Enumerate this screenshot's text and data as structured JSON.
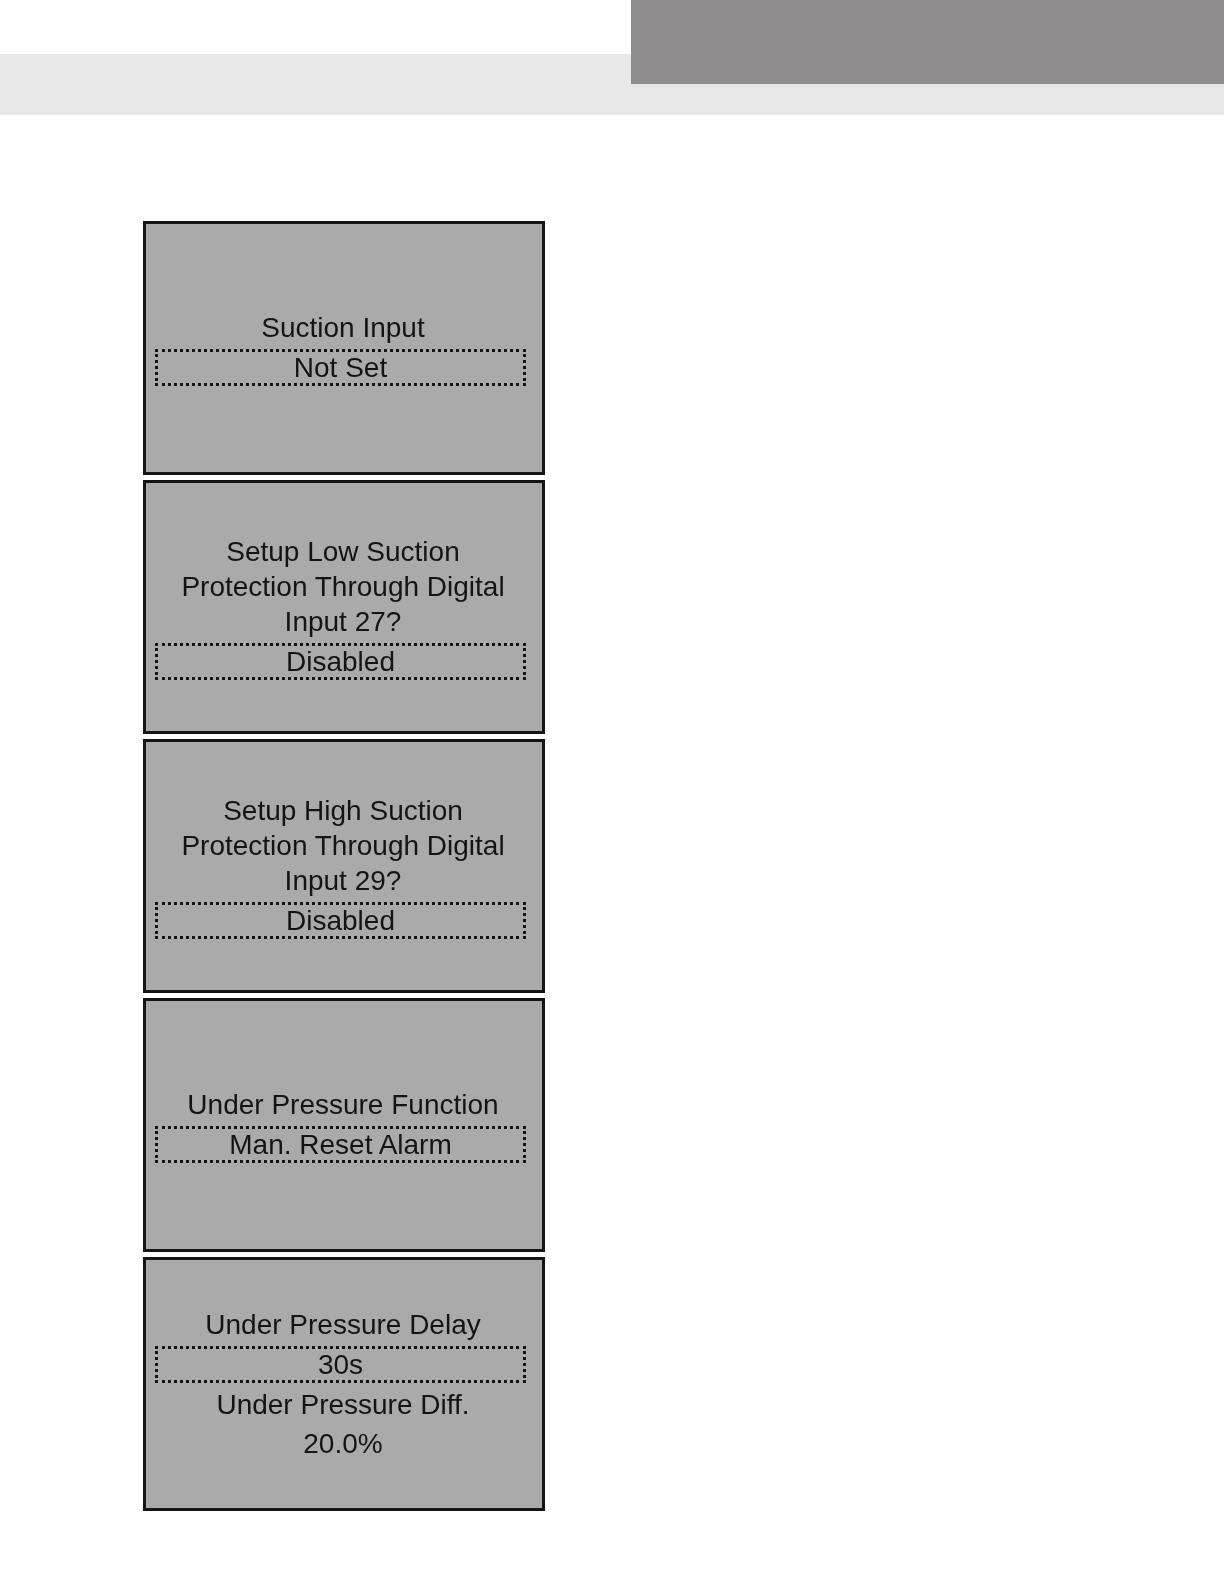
{
  "screens": [
    {
      "items": [
        {
          "kind": "label",
          "text": "Suction Input"
        },
        {
          "kind": "field",
          "value": "Not Set"
        }
      ]
    },
    {
      "items": [
        {
          "kind": "label",
          "text": "Setup Low Suction Protection Through Digital Input 27?"
        },
        {
          "kind": "field",
          "value": "Disabled"
        }
      ]
    },
    {
      "items": [
        {
          "kind": "label",
          "text": "Setup High Suction Protection Through Digital Input 29?"
        },
        {
          "kind": "field",
          "value": "Disabled"
        }
      ]
    },
    {
      "items": [
        {
          "kind": "label",
          "text": "Under Pressure Function"
        },
        {
          "kind": "field",
          "value": "Man. Reset Alarm"
        }
      ]
    },
    {
      "items": [
        {
          "kind": "label",
          "text": "Under Pressure Delay"
        },
        {
          "kind": "field",
          "value": "30s"
        },
        {
          "kind": "label",
          "text": "Under Pressure Diff."
        },
        {
          "kind": "label",
          "text": "20.0%"
        }
      ]
    }
  ]
}
